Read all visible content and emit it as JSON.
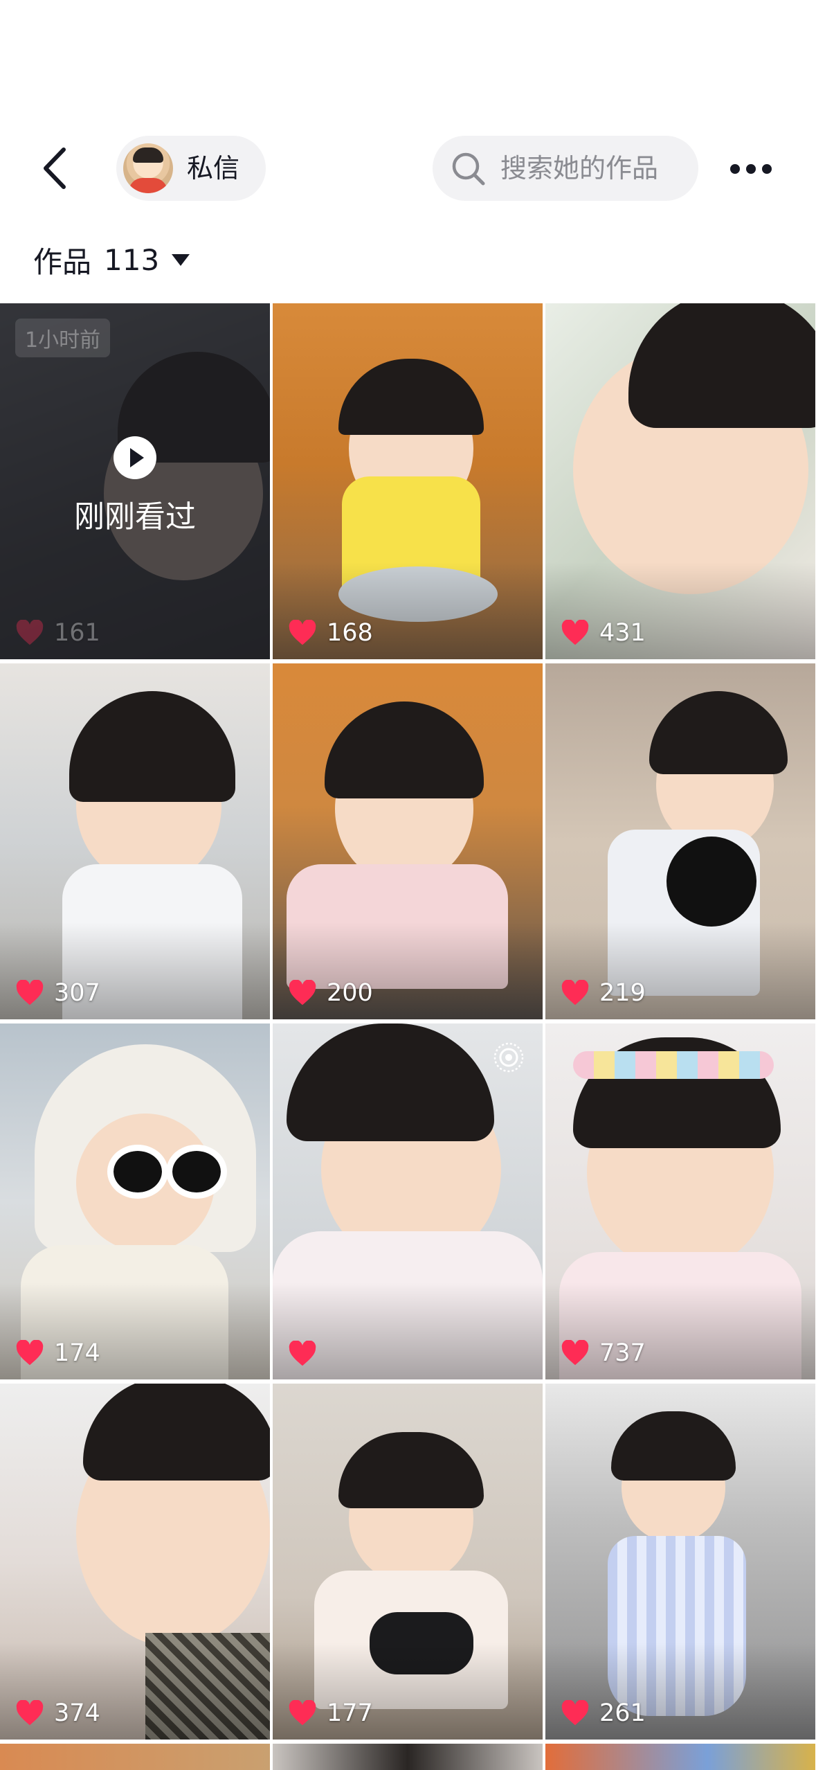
{
  "header": {
    "dm_label": "私信",
    "search_placeholder": "搜索她的作品"
  },
  "works": {
    "label": "作品",
    "count": "113"
  },
  "grid": {
    "watched_badge": "1小时前",
    "watched_label": "刚刚看过",
    "tiles": [
      {
        "likes": "161"
      },
      {
        "likes": "168"
      },
      {
        "likes": "431"
      },
      {
        "likes": "307"
      },
      {
        "likes": "200"
      },
      {
        "likes": "219"
      },
      {
        "likes": "174"
      },
      {
        "likes": ""
      },
      {
        "likes": "737"
      },
      {
        "likes": "374"
      },
      {
        "likes": "177"
      },
      {
        "likes": "261"
      }
    ]
  },
  "colors": {
    "heart": "#fe2c55",
    "pill_bg": "#f2f2f4"
  },
  "icons": [
    "back-arrow-icon",
    "search-icon",
    "more-icon",
    "caret-down-icon",
    "heart-icon",
    "play-icon",
    "live-photo-icon"
  ]
}
